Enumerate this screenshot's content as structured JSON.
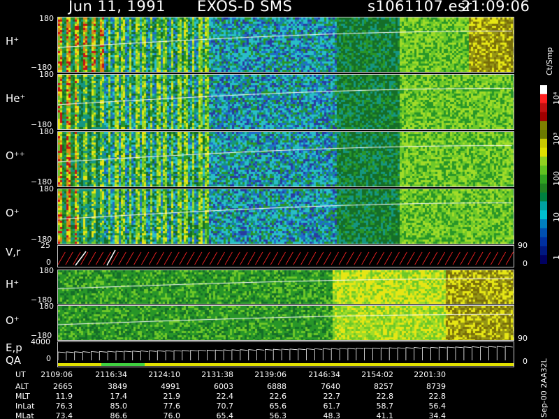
{
  "header": {
    "date": "Jun 11, 1991",
    "instrument": "EXOS-D SMS",
    "file": "s1061107.esr",
    "time": "21:09:06"
  },
  "colorbar": {
    "unit": "Ct/Smp",
    "ticks": [
      "10⁴",
      "10³",
      "100",
      "10",
      "1"
    ]
  },
  "footer_tag": "Sep-00  2AA32L",
  "panels": {
    "h_plus": {
      "label": "H⁺",
      "top": "180",
      "bottom": "−180"
    },
    "he_plus": {
      "label": "He⁺",
      "top": "180",
      "bottom": "−180"
    },
    "o_pp": {
      "label": "O⁺⁺",
      "top": "180",
      "bottom": "−180"
    },
    "o_plus": {
      "label": "O⁺",
      "top": "180",
      "bottom": "−180"
    },
    "vr": {
      "label": "V,r",
      "top": "25",
      "zero": "0",
      "right_top": "90",
      "right_zero": "0"
    },
    "h_plus_2": {
      "label": "H⁺",
      "top": "180",
      "bottom": "−180"
    },
    "o_plus_2": {
      "label": "O⁺",
      "top": "180",
      "bottom": "−180",
      "right": "90"
    },
    "ep": {
      "label1": "E,p",
      "label2": "QA",
      "top": "4000",
      "zero": "0",
      "right_zero": "0"
    }
  },
  "table": {
    "rows": [
      {
        "label": "UT",
        "values": [
          "2109:06",
          "2116:34",
          "2124:10",
          "2131:38",
          "2139:06",
          "2146:34",
          "2154:02",
          "2201:30"
        ]
      },
      {
        "label": "ALT",
        "values": [
          "2665",
          "3849",
          "4991",
          "6003",
          "6888",
          "7640",
          "8257",
          "8739"
        ]
      },
      {
        "label": "MLT",
        "values": [
          "11.9",
          "17.4",
          "21.9",
          "22.4",
          "22.6",
          "22.7",
          "22.8",
          "22.8"
        ]
      },
      {
        "label": "InLat",
        "values": [
          "76.3",
          "85.0",
          "77.6",
          "70.7",
          "65.6",
          "61.7",
          "58.7",
          "56.4"
        ]
      },
      {
        "label": "MLat",
        "values": [
          "73.4",
          "86.6",
          "76.0",
          "65.4",
          "56.3",
          "48.3",
          "41.1",
          "34.4"
        ]
      }
    ]
  },
  "chart_data": {
    "type": "heatmap",
    "title": "Jun 11, 1991   EXOS-D SMS",
    "x_ticks": [
      "2109:06",
      "2116:34",
      "2124:10",
      "2131:38",
      "2139:06",
      "2146:34",
      "2154:02",
      "2201:30"
    ],
    "panels": [
      {
        "name": "H⁺",
        "y_range": [
          -180,
          180
        ]
      },
      {
        "name": "He⁺",
        "y_range": [
          -180,
          180
        ]
      },
      {
        "name": "O⁺⁺",
        "y_range": [
          -180,
          180
        ]
      },
      {
        "name": "O⁺",
        "y_range": [
          -180,
          180
        ]
      },
      {
        "name": "V,r",
        "y_range": [
          0,
          25
        ]
      },
      {
        "name": "H⁺",
        "y_range": [
          -180,
          180
        ]
      },
      {
        "name": "O⁺",
        "y_range": [
          -180,
          180
        ]
      },
      {
        "name": "E,p",
        "y_range": [
          0,
          4000
        ]
      }
    ],
    "colorbar": {
      "unit": "Ct/Smp",
      "scale": "log",
      "range": [
        1,
        10000
      ]
    }
  }
}
